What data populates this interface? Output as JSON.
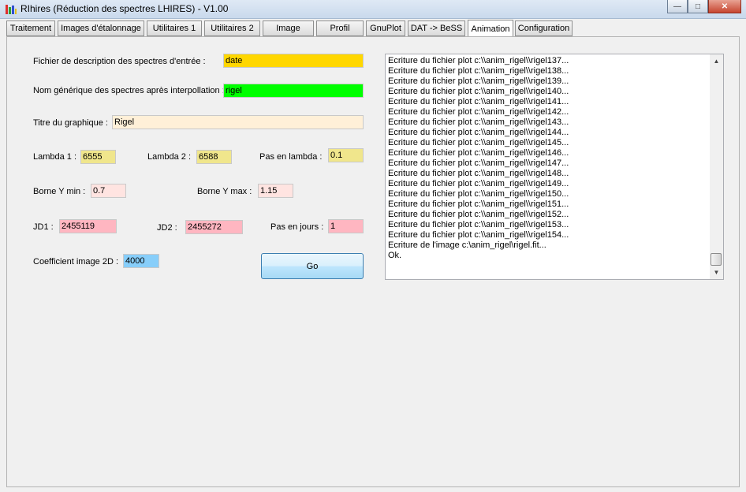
{
  "window": {
    "title": "RIhires (Réduction des spectres LHIRES) - V1.00"
  },
  "tabs": [
    "Traitement",
    "Images d'étalonnage",
    "Utilitaires 1",
    "Utilitaires 2",
    "Image",
    "Profil",
    "GnuPlot",
    "DAT -> BeSS",
    "Animation",
    "Configuration"
  ],
  "active_tab": "Animation",
  "form": {
    "input_file_label": "Fichier de description des spectres d'entrée :",
    "input_file_value": "date",
    "generic_name_label": "Nom générique des spectres après interpollation :",
    "generic_name_value": "rigel",
    "graph_title_label": "Titre du graphique :",
    "graph_title_value": "Rigel",
    "lambda1_label": "Lambda 1 :",
    "lambda1_value": "6555",
    "lambda2_label": "Lambda 2 :",
    "lambda2_value": "6588",
    "lambda_step_label": "Pas en lambda :",
    "lambda_step_value": "0.1",
    "ymin_label": "Borne Y min :",
    "ymin_value": "0.7",
    "ymax_label": "Borne Y max :",
    "ymax_value": "1.15",
    "jd1_label": "JD1 :",
    "jd1_value": "2455119",
    "jd2_label": "JD2 :",
    "jd2_value": "2455272",
    "day_step_label": "Pas en jours :",
    "day_step_value": "1",
    "coef_label": "Coefficient image 2D :",
    "coef_value": "4000",
    "go_label": "Go"
  },
  "log": [
    "Ecriture du fichier plot c:\\\\anim_rigel\\\\rigel137...",
    "Ecriture du fichier plot c:\\\\anim_rigel\\\\rigel138...",
    "Ecriture du fichier plot c:\\\\anim_rigel\\\\rigel139...",
    "Ecriture du fichier plot c:\\\\anim_rigel\\\\rigel140...",
    "Ecriture du fichier plot c:\\\\anim_rigel\\\\rigel141...",
    "Ecriture du fichier plot c:\\\\anim_rigel\\\\rigel142...",
    "Ecriture du fichier plot c:\\\\anim_rigel\\\\rigel143...",
    "Ecriture du fichier plot c:\\\\anim_rigel\\\\rigel144...",
    "Ecriture du fichier plot c:\\\\anim_rigel\\\\rigel145...",
    "Ecriture du fichier plot c:\\\\anim_rigel\\\\rigel146...",
    "Ecriture du fichier plot c:\\\\anim_rigel\\\\rigel147...",
    "Ecriture du fichier plot c:\\\\anim_rigel\\\\rigel148...",
    "Ecriture du fichier plot c:\\\\anim_rigel\\\\rigel149...",
    "Ecriture du fichier plot c:\\\\anim_rigel\\\\rigel150...",
    "Ecriture du fichier plot c:\\\\anim_rigel\\\\rigel151...",
    "Ecriture du fichier plot c:\\\\anim_rigel\\\\rigel152...",
    "Ecriture du fichier plot c:\\\\anim_rigel\\\\rigel153...",
    "Ecriture du fichier plot c:\\\\anim_rigel\\\\rigel154...",
    "Ecriture de l'image c:\\anim_rigel\\rigel.fit...",
    "Ok."
  ],
  "colors": {
    "input_file": "#ffd700",
    "generic_name": "#00ff00",
    "graph_title": "#fff0d8",
    "lambda": "#f0e68c",
    "bounds": "#ffe4e1",
    "jd": "#ffb6c1",
    "coef": "#87cefa"
  },
  "icons": {
    "window_minimize": "minimize-icon",
    "window_maximize": "maximize-icon",
    "window_close": "close-icon"
  }
}
